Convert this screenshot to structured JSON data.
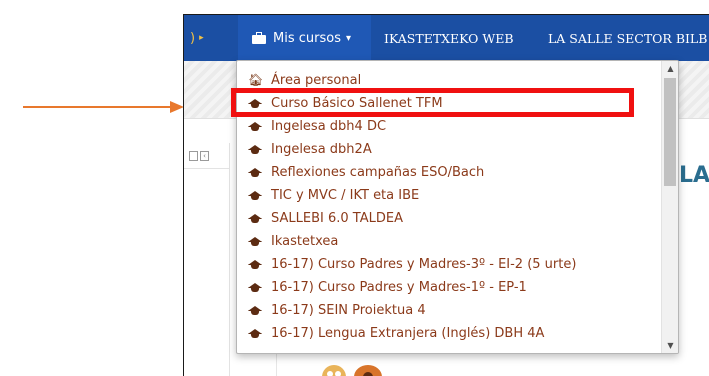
{
  "navbar": {
    "prev_item_text": ")",
    "prev_caret": "▸",
    "mis_cursos_label": "Mis cursos",
    "mis_cursos_caret": "▾",
    "links": [
      "IKASTETXEKO WEB",
      "LA SALLE SECTOR BILB"
    ]
  },
  "page_heading_fragment": "LA",
  "panel_icons": [
    "",
    "‹"
  ],
  "dropdown": {
    "items": [
      {
        "label": "Área personal",
        "icon": "home-icon"
      },
      {
        "label": "Curso Básico Sallenet TFM",
        "icon": "graduation-cap-icon"
      },
      {
        "label": "Ingelesa dbh4 DC",
        "icon": "graduation-cap-icon"
      },
      {
        "label": "Ingelesa dbh2A",
        "icon": "graduation-cap-icon"
      },
      {
        "label": "Reflexiones campañas ESO/Bach",
        "icon": "graduation-cap-icon"
      },
      {
        "label": "TIC y MVC / IKT eta IBE",
        "icon": "graduation-cap-icon"
      },
      {
        "label": "SALLEBI 6.0 TALDEA",
        "icon": "graduation-cap-icon"
      },
      {
        "label": "Ikastetxea",
        "icon": "graduation-cap-icon"
      },
      {
        "label": "16-17) Curso Padres y Madres-3º - EI-2 (5 urte)",
        "icon": "graduation-cap-icon"
      },
      {
        "label": "16-17) Curso Padres y Madres-1º - EP-1",
        "icon": "graduation-cap-icon"
      },
      {
        "label": "16-17) SEIN Proiektua 4",
        "icon": "graduation-cap-icon"
      },
      {
        "label": "16-17) Lengua Extranjera (Inglés) DBH 4A",
        "icon": "graduation-cap-icon"
      }
    ],
    "scroll_up": "▲",
    "scroll_down": "▼"
  },
  "colors": {
    "navbar": "#1b4fa3",
    "item_text": "#8b3a1a",
    "highlight": "#f01010",
    "arrow": "#e8782d",
    "heading": "#2a6d8f"
  }
}
